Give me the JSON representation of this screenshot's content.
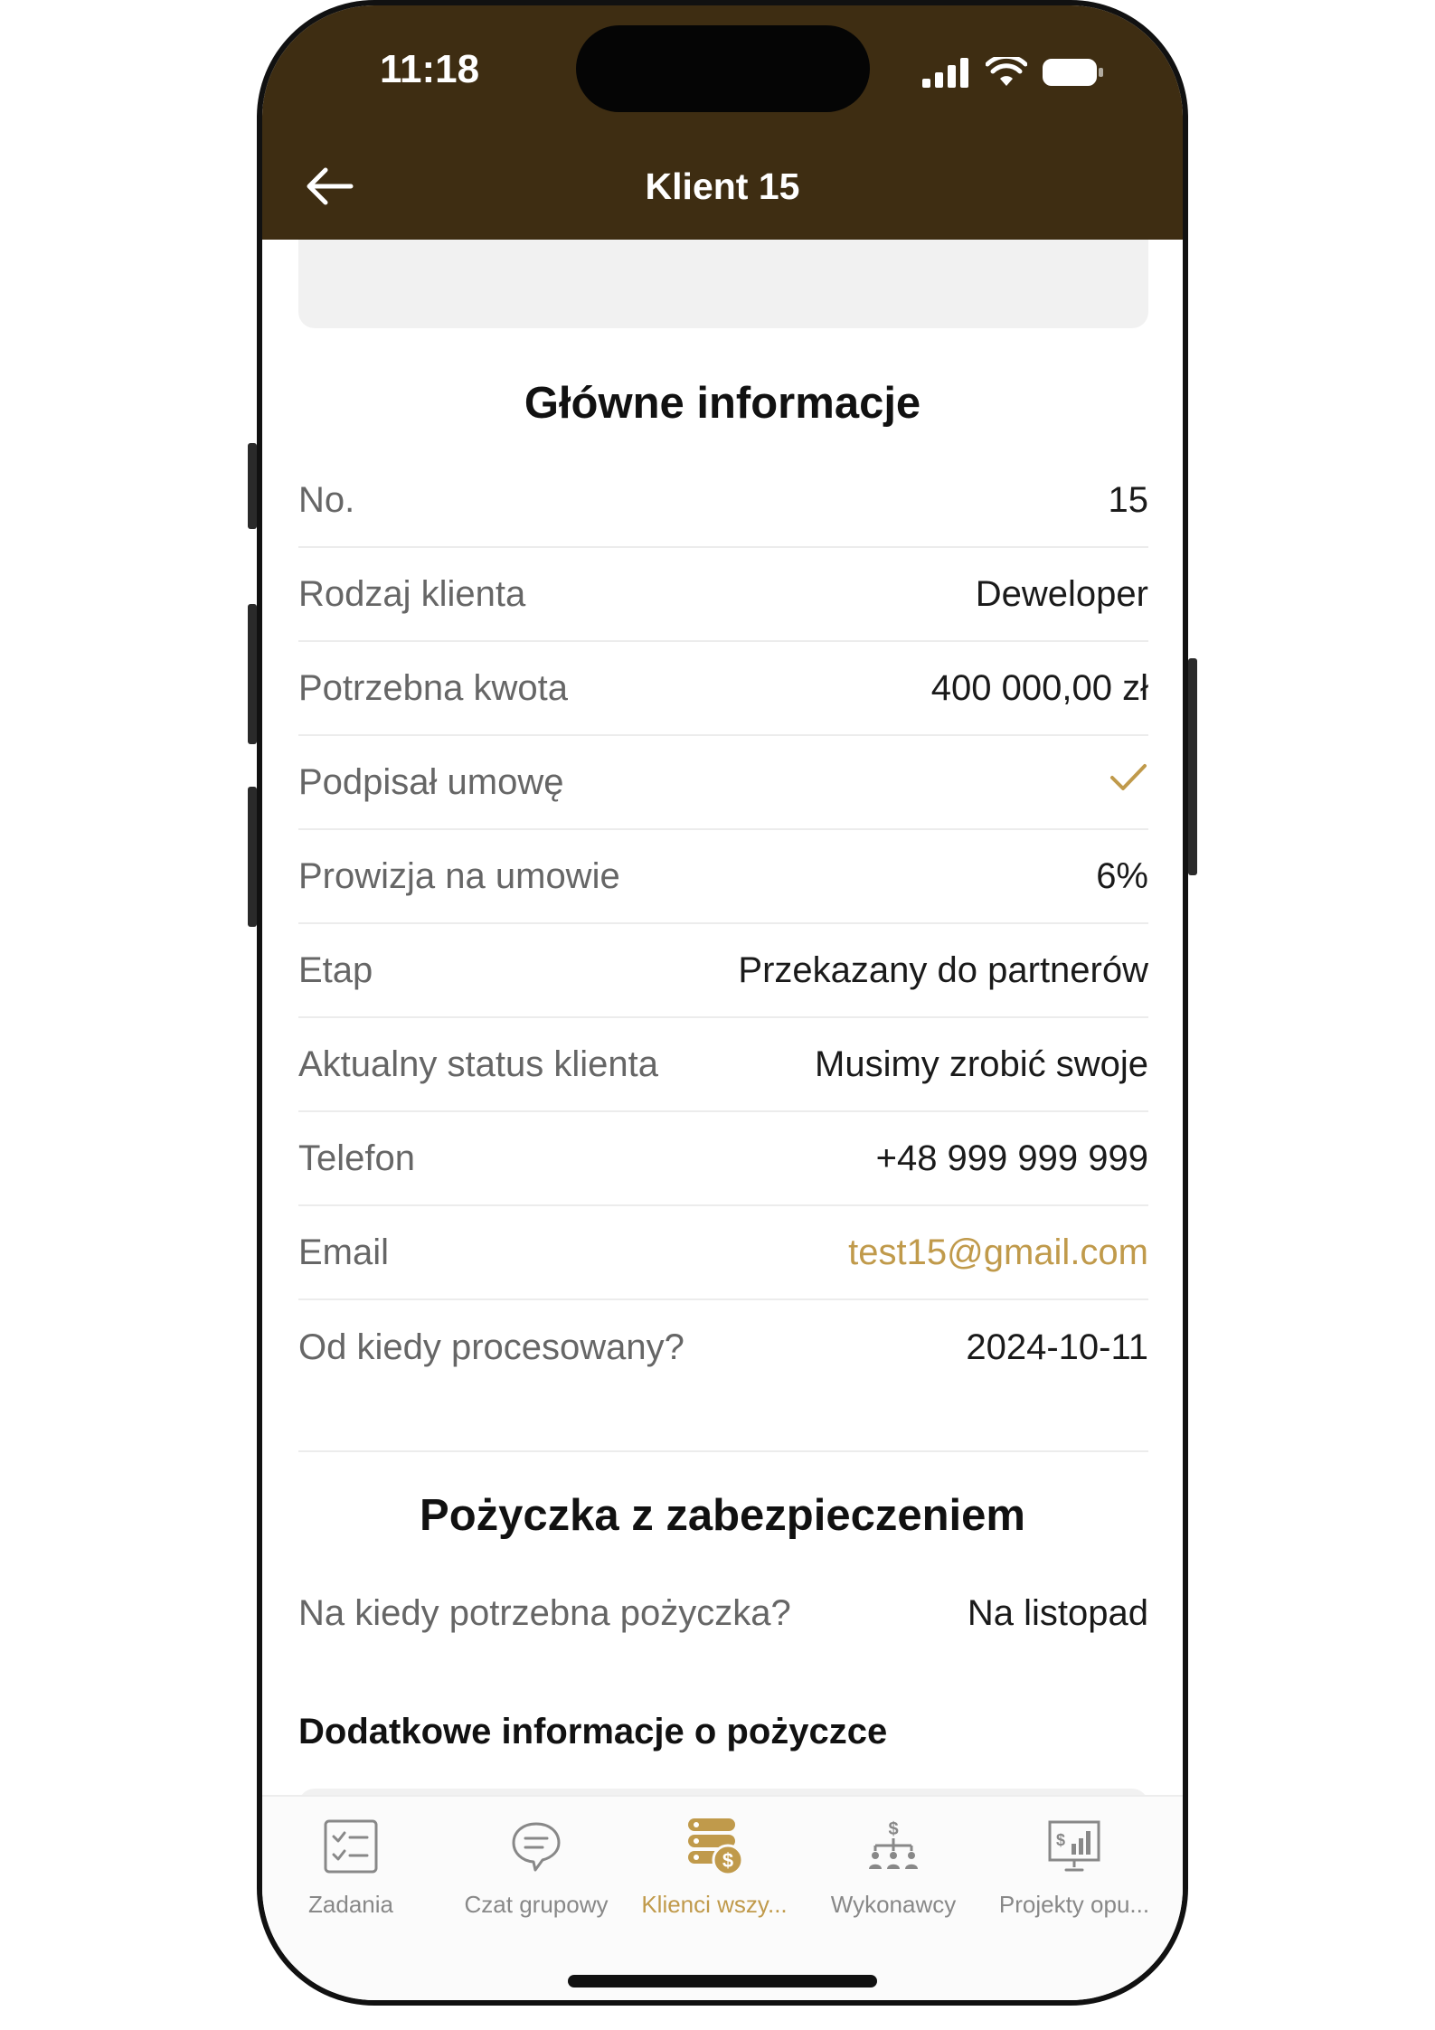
{
  "status_bar": {
    "time": "11:18"
  },
  "header": {
    "title": "Klient 15",
    "background_color": "#3e2d12"
  },
  "main_info": {
    "heading": "Główne informacje",
    "rows": [
      {
        "label": "No.",
        "value": "15"
      },
      {
        "label": "Rodzaj klienta",
        "value": "Deweloper"
      },
      {
        "label": "Potrzebna kwota",
        "value": "400 000,00 zł"
      },
      {
        "label": "Podpisał umowę",
        "value": "",
        "icon": "check-icon"
      },
      {
        "label": "Prowizja na umowie",
        "value": "6%"
      },
      {
        "label": "Etap",
        "value": "Przekazany do partnerów"
      },
      {
        "label": "Aktualny status klienta",
        "value": "Musimy zrobić swoje"
      },
      {
        "label": "Telefon",
        "value": "+48 999 999 999"
      },
      {
        "label": "Email",
        "value": "test15@gmail.com"
      },
      {
        "label": "Od kiedy procesowany?",
        "value": "2024-10-11"
      }
    ]
  },
  "loan": {
    "heading": "Pożyczka z zabezpieczeniem",
    "when_label": "Na kiedy potrzebna pożyczka?",
    "when_value": "Na listopad",
    "extra_heading": "Dodatkowe informacje o pożyczce"
  },
  "tabbar": {
    "active_color": "#c09a4b",
    "items": [
      {
        "label": "Zadania",
        "icon": "checklist-icon"
      },
      {
        "label": "Czat grupowy",
        "icon": "chat-icon"
      },
      {
        "label": "Klienci wszy...",
        "icon": "clients-money-icon",
        "active": true
      },
      {
        "label": "Wykonawcy",
        "icon": "org-dollar-icon"
      },
      {
        "label": "Projekty opu...",
        "icon": "chart-board-icon"
      }
    ]
  }
}
